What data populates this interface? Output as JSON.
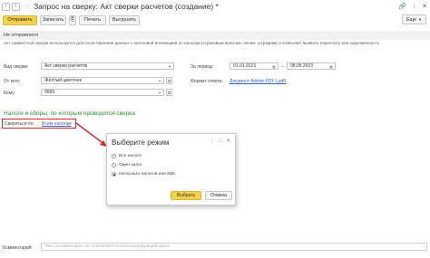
{
  "window": {
    "title": "Запрос на сверку: Акт сверки расчетов (создание) *"
  },
  "toolbar": {
    "send_label": "Отправить",
    "save_label": "Записать",
    "print_label": "Печать",
    "export_label": "Выгрузить",
    "more_label": "Еще"
  },
  "status": {
    "text": "Не отправлено"
  },
  "info": {
    "text": "Акт совместной сверки используется для сопоставления данных с налоговой инспекцией по налогам (страховым взносам, пеням, штрафам) и позволяет выявить переплату или задолженность"
  },
  "form": {
    "request_type_label": "Вид сверки:",
    "request_type_value": "Акт сверки расчетов",
    "from_label": "От кого:",
    "from_value": "Жёлтый цветочек",
    "to_label": "Кому:",
    "to_value": "9999",
    "period_label": "За период:",
    "period_from": "01.01.2023",
    "period_sep": "–",
    "period_to": "08.05.2023",
    "format_label": "Формат ответа:",
    "format_value": "Документ Adobe PDF (.pdf)"
  },
  "taxes": {
    "section_title": "Налоги и сборы, по которым проводится сверка",
    "reconcile_label": "Сверяться по:",
    "reconcile_value": "Всем налогам"
  },
  "dialog": {
    "title": "Выберите режим",
    "options": [
      {
        "label": "Все налоги",
        "selected": false
      },
      {
        "label": "Один налог",
        "selected": false
      },
      {
        "label": "Несколько налогов или КБК",
        "selected": true
      }
    ],
    "select_label": "Выбрать",
    "cancel_label": "Отмена"
  },
  "footer": {
    "comment_label": "Комментарий:",
    "comment_placeholder": "Текст комментария не отправляется в контролирующий орган"
  },
  "colors": {
    "primary": "#f6d24a",
    "accent_red": "#d62b2b",
    "section_green": "#2f8f3a",
    "link_blue": "#3b63b5"
  }
}
